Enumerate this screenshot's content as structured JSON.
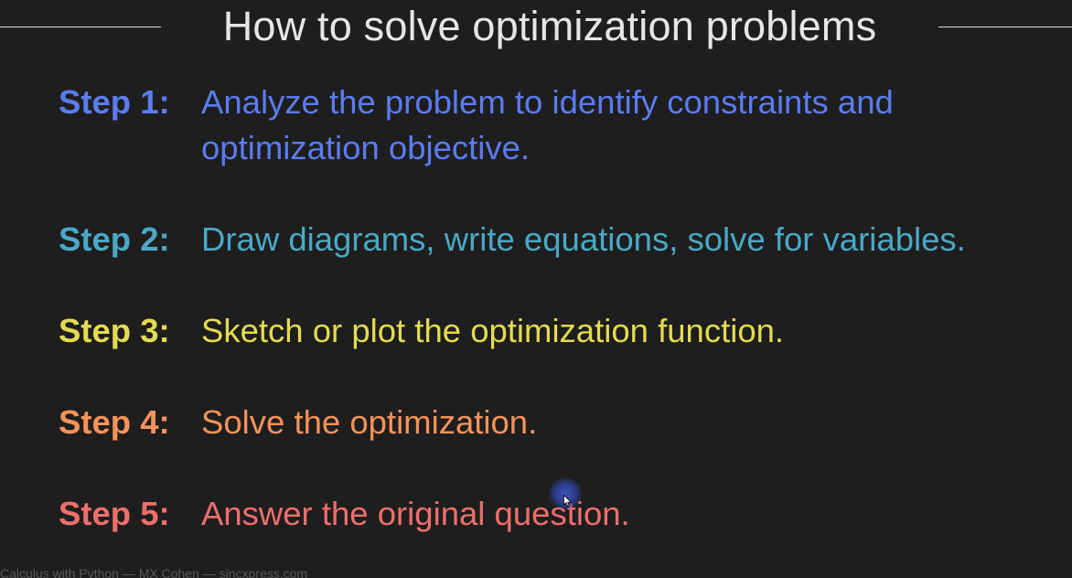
{
  "slide": {
    "title": "How to solve optimization problems",
    "steps": [
      {
        "label": "Step 1:",
        "text": "Analyze the problem to identify constraints and optimization objective.",
        "color": "#5b7cf0"
      },
      {
        "label": "Step 2:",
        "text": "Draw diagrams, write equations, solve for variables.",
        "color": "#4aa9c6"
      },
      {
        "label": "Step 3:",
        "text": "Sketch or plot the optimization function.",
        "color": "#e3db52"
      },
      {
        "label": "Step 4:",
        "text": "Solve the optimization.",
        "color": "#f5935a"
      },
      {
        "label": "Step 5:",
        "text": "Answer the original question.",
        "color": "#ee6f6c"
      }
    ],
    "footer": "Calculus with Python  —  MX Cohen  —  sincxpress.com"
  },
  "colors": {
    "background": "#1e1e1e",
    "title": "#e6e6e6",
    "rule": "#d8d8d8",
    "cursor_highlight": "#3c5ac8"
  },
  "icons": {
    "cursor": "mouse-cursor-icon"
  }
}
